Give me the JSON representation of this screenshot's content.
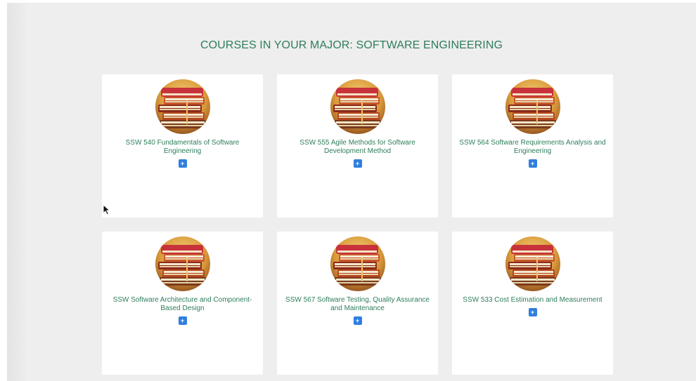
{
  "page": {
    "title": "COURSES IN YOUR MAJOR: SOFTWARE ENGINEERING"
  },
  "courses": [
    {
      "title": "SSW 540 Fundamentals of Software Engineering",
      "add_label": "+",
      "image_icon": "books-stack-image"
    },
    {
      "title": "SSW 555 Agile Methods for Software Development Method",
      "add_label": "+",
      "image_icon": "books-stack-image"
    },
    {
      "title": "SSW 564 Software Requirements Analysis and Engineering",
      "add_label": "+",
      "image_icon": "books-stack-image"
    },
    {
      "title": "SSW Software Architecture and Component-Based Design",
      "add_label": "+",
      "image_icon": "books-stack-image"
    },
    {
      "title": "SSW 567 Software Testing, Quality Assurance and Maintenance",
      "add_label": "+",
      "image_icon": "books-stack-image"
    },
    {
      "title": "SSW 533 Cost Estimation and Measurement",
      "add_label": "+",
      "image_icon": "books-stack-image"
    }
  ],
  "colors": {
    "accent_text": "#2e7d5b",
    "add_button": "#2f7fe0",
    "background": "#eeeeee",
    "card": "#ffffff"
  }
}
